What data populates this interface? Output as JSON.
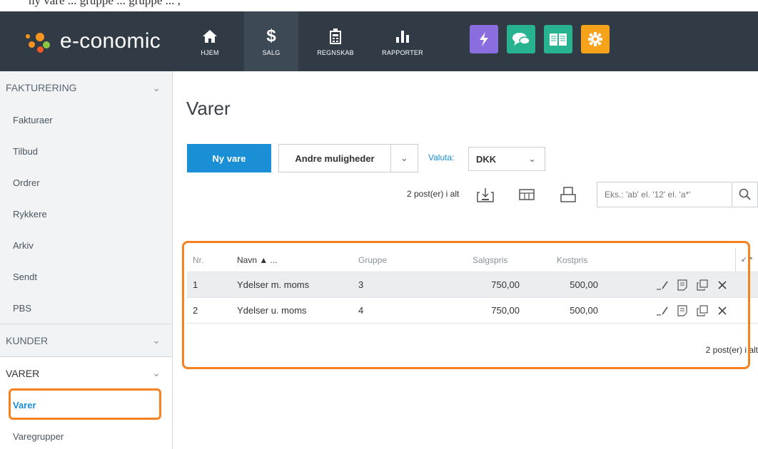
{
  "caption": "ny vare ... gruppe ... gruppe ... ,",
  "brand": {
    "name": "e-conomic"
  },
  "nav": [
    {
      "label": "HJEM",
      "icon": "home-icon"
    },
    {
      "label": "SALG",
      "icon": "dollar-icon",
      "active": true
    },
    {
      "label": "REGNSKAB",
      "icon": "calculator-icon"
    },
    {
      "label": "RAPPORTER",
      "icon": "bar-chart-icon"
    }
  ],
  "apps": [
    {
      "icon": "lightning-icon",
      "color": "#8a6ee0"
    },
    {
      "icon": "chat-icon",
      "color": "#27b38f"
    },
    {
      "icon": "book-icon",
      "color": "#27b38f"
    },
    {
      "icon": "gear-icon",
      "color": "#f7a21b"
    }
  ],
  "sidebar": {
    "fakturering": {
      "title": "FAKTURERING",
      "items": [
        "Fakturaer",
        "Tilbud",
        "Ordrer",
        "Rykkere",
        "Arkiv",
        "Sendt",
        "PBS"
      ]
    },
    "kunder": {
      "title": "KUNDER"
    },
    "varer": {
      "title": "VARER",
      "items": [
        "Varer",
        "Varegrupper"
      ],
      "active": "Varer"
    }
  },
  "page": {
    "title": "Varer",
    "new_button": "Ny vare",
    "more_button": "Andre muligheder",
    "currency_label": "Valuta:",
    "currency_value": "DKK",
    "count_text": "2 post(er) i alt",
    "search_placeholder": "Eks.: 'ab' el. '12' el. 'a*'"
  },
  "table": {
    "columns": {
      "nr": "Nr.",
      "navn": "Navn ▲ ...",
      "gruppe": "Gruppe",
      "salgspris": "Salgspris",
      "kostpris": "Kostpris"
    },
    "rows": [
      {
        "nr": "1",
        "navn": "Ydelser m. moms",
        "gruppe": "3",
        "salgspris": "750,00",
        "kostpris": "500,00"
      },
      {
        "nr": "2",
        "navn": "Ydelser u. moms",
        "gruppe": "4",
        "salgspris": "750,00",
        "kostpris": "500,00"
      }
    ],
    "footer_count": "2 post(er) i alt"
  },
  "colors": {
    "topbar": "#303b46",
    "accent": "#1a8fd6",
    "highlight": "#f58220",
    "brand_orange": "#f7941d",
    "brand_green": "#8dc63f"
  }
}
